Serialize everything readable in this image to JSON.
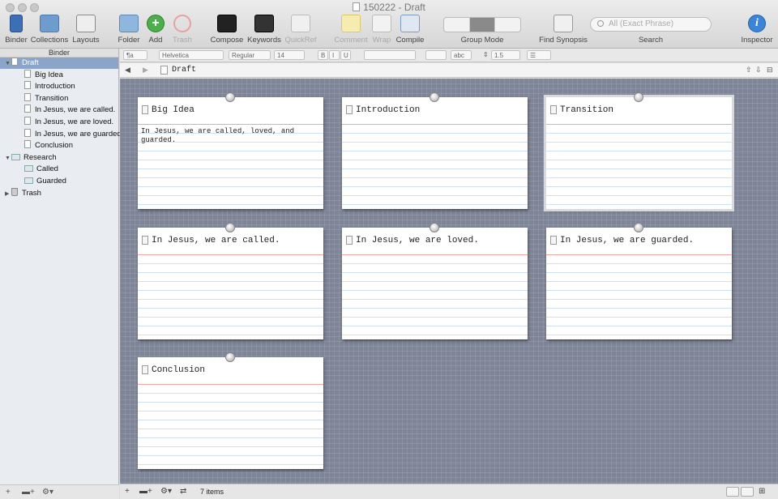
{
  "window": {
    "title": "150222 - Draft"
  },
  "toolbar": {
    "binder": "Binder",
    "collections": "Collections",
    "layouts": "Layouts",
    "folder": "Folder",
    "add": "Add",
    "trash": "Trash",
    "compose": "Compose",
    "keywords": "Keywords",
    "quickref": "QuickRef",
    "comment": "Comment",
    "wrap": "Wrap",
    "compile": "Compile",
    "group_mode": "Group Mode",
    "find_synopsis": "Find Synopsis",
    "search_placeholder": "All (Exact Phrase)",
    "search_label": "Search",
    "inspector": "Inspector"
  },
  "formatbar": {
    "style": "¶a",
    "font": "Helvetica",
    "weight": "Regular",
    "size": "14",
    "bold": "B",
    "italic": "I",
    "underline": "U",
    "highlight": "abc",
    "spacing": "1.5"
  },
  "binder": {
    "header": "Binder",
    "items": [
      {
        "label": "Draft",
        "kind": "draft",
        "indent": 0,
        "expanded": true,
        "selected": true
      },
      {
        "label": "Big Idea",
        "kind": "doc",
        "indent": 1
      },
      {
        "label": "Introduction",
        "kind": "doc",
        "indent": 1
      },
      {
        "label": "Transition",
        "kind": "doc",
        "indent": 1
      },
      {
        "label": "In Jesus, we are called.",
        "kind": "doc",
        "indent": 1
      },
      {
        "label": "In Jesus, we are loved.",
        "kind": "doc",
        "indent": 1
      },
      {
        "label": "In Jesus, we are guarded.",
        "kind": "doc",
        "indent": 1
      },
      {
        "label": "Conclusion",
        "kind": "doc",
        "indent": 1
      },
      {
        "label": "Research",
        "kind": "research",
        "indent": 0,
        "expanded": true
      },
      {
        "label": "Called",
        "kind": "folder",
        "indent": 1
      },
      {
        "label": "Guarded",
        "kind": "folder",
        "indent": 1
      },
      {
        "label": "Trash",
        "kind": "trash",
        "indent": 0,
        "expanded": false
      }
    ]
  },
  "editor": {
    "header_title": "Draft",
    "cards": [
      {
        "title": "Big Idea",
        "synopsis": "In Jesus, we are called, loved, and guarded.",
        "selected": false
      },
      {
        "title": "Introduction",
        "synopsis": "",
        "selected": false
      },
      {
        "title": "Transition",
        "synopsis": "",
        "selected": true
      },
      {
        "title": "In Jesus, we are called.",
        "synopsis": "",
        "selected": false
      },
      {
        "title": "In Jesus, we are loved.",
        "synopsis": "",
        "selected": false
      },
      {
        "title": "In Jesus, we are guarded.",
        "synopsis": "",
        "selected": false
      },
      {
        "title": "Conclusion",
        "synopsis": "",
        "selected": false
      }
    ]
  },
  "footer": {
    "item_count": "7 items"
  },
  "colors": {
    "corkboard": "#7e8597",
    "selection": "#8aa5c9",
    "card_header_rule": "#f1a6a6",
    "card_lines": "#cfe0f2"
  }
}
